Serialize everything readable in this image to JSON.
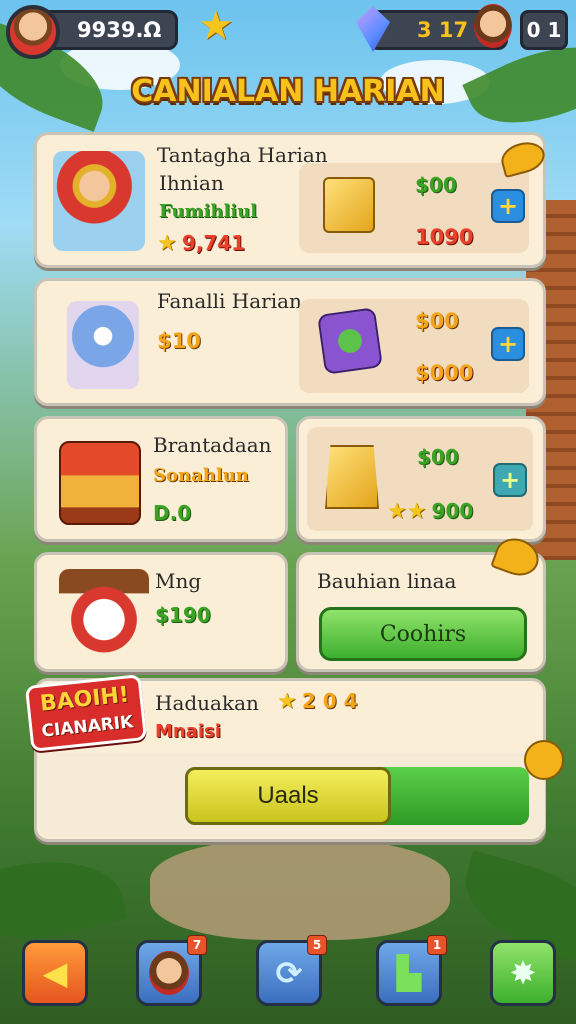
{
  "top_bar": {
    "coins": "9939.Ω",
    "gems": "3 17",
    "energy": "0 1"
  },
  "title": "CANIALAN HARIAN",
  "card1": {
    "title_line1": "Tantagha Harian",
    "title_line2": "Ihnian",
    "subtitle": "Fumihliul",
    "score": "9,741",
    "price": "$00",
    "cost": "1090"
  },
  "card2": {
    "title": "Fanalli Harian",
    "value": "$10",
    "price": "$00",
    "cost": "$000"
  },
  "card3": {
    "title": "Brantadaan",
    "subtitle": "Sonahlun",
    "value": "D.0"
  },
  "card4": {
    "price": "$00",
    "score": "900"
  },
  "card5": {
    "title": "Mng",
    "value": "$190"
  },
  "card6": {
    "title": "Bauhian linaa",
    "button_label": "Coohirs"
  },
  "card7": {
    "sticker_line1": "BAOIH!",
    "sticker_line2": "CIANARIK",
    "title": "Haduakan",
    "score": "2 0 4",
    "subtitle": "Mnaisi",
    "button_label": "Uaals"
  },
  "nav": {
    "badge_profile": "7",
    "badge_refresh": "5",
    "badge_boot": "1"
  },
  "colors": {
    "accent_yellow": "#f7c21c",
    "accent_green": "#3eaf2e",
    "accent_blue": "#2a8fe0",
    "accent_red": "#e8402a"
  },
  "icons": [
    "avatar",
    "star-icon",
    "gem-icon",
    "energy-icon",
    "plus-icon",
    "back-icon",
    "profile-icon",
    "refresh-icon",
    "boot-icon",
    "settings-icon"
  ]
}
